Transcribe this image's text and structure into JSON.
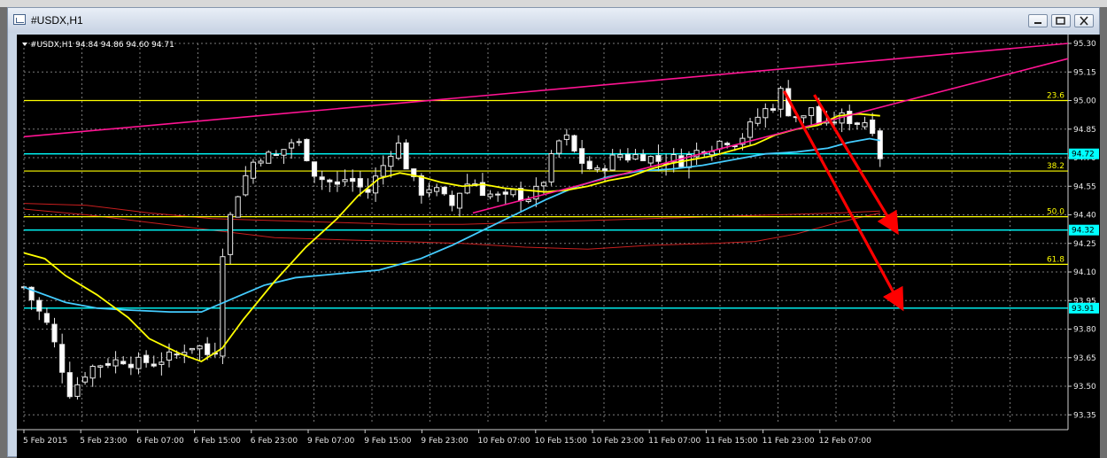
{
  "window": {
    "title": "#USDX,H1",
    "buttons": {
      "minimize": "minimize",
      "restore": "restore",
      "close": "close"
    }
  },
  "header": {
    "symbol_line": "#USDX,H1  94.84 94.86 94.60 94.71"
  },
  "colors": {
    "background": "#000000",
    "grid": "#7a7a7a",
    "bull_candle": "#ffffff",
    "bear_candle": "#ffffff",
    "fib": "#ffff00",
    "support": "#00ffff",
    "trendline": "#ff1493",
    "ma_fast": "#ffff00",
    "ma_slow": "#44ccff",
    "ma_envelope": "#c81e1e",
    "arrow": "#ff0000"
  },
  "chart_data": {
    "type": "candlestick",
    "ylim": [
      93.3,
      95.3
    ],
    "y_ticks": [
      "95.30",
      "95.15",
      "95.00",
      "94.85",
      "94.70",
      "94.55",
      "94.40",
      "94.25",
      "94.10",
      "93.95",
      "93.80",
      "93.65",
      "93.50",
      "93.35"
    ],
    "x_labels": [
      "5 Feb 2015",
      "5 Feb 23:00",
      "6 Feb 07:00",
      "6 Feb 15:00",
      "6 Feb 23:00",
      "9 Feb 07:00",
      "9 Feb 15:00",
      "9 Feb 23:00",
      "10 Feb 07:00",
      "10 Feb 15:00",
      "10 Feb 23:00",
      "11 Feb 07:00",
      "11 Feb 15:00",
      "11 Feb 23:00",
      "12 Feb 07:00"
    ],
    "bars_count": 113,
    "fib_levels": [
      {
        "label": "23.6",
        "price": 95.0
      },
      {
        "label": "38.2",
        "price": 94.63
      },
      {
        "label": "50.0",
        "price": 94.39
      },
      {
        "label": "61.8",
        "price": 94.14
      }
    ],
    "support_lines": [
      {
        "label": "94.72",
        "price": 94.72
      },
      {
        "label": "94.32",
        "price": 94.32
      },
      {
        "label": "93.91",
        "price": 93.91
      }
    ],
    "current_price": "94.71",
    "trendlines": [
      {
        "from": [
          0.0,
          94.81
        ],
        "to": [
          1.0,
          95.3
        ]
      },
      {
        "from": [
          0.43,
          94.41
        ],
        "to": [
          1.0,
          95.22
        ]
      }
    ],
    "arrows": [
      {
        "from": [
          0.728,
          95.05
        ],
        "to": [
          0.84,
          93.92
        ]
      },
      {
        "from": [
          0.757,
          95.03
        ],
        "to": [
          0.835,
          94.32
        ]
      }
    ],
    "series": [
      {
        "key": "ma_fast",
        "values": [
          [
            0,
            94.2
          ],
          [
            0.02,
            94.17
          ],
          [
            0.04,
            94.08
          ],
          [
            0.07,
            93.98
          ],
          [
            0.1,
            93.86
          ],
          [
            0.12,
            93.75
          ],
          [
            0.15,
            93.67
          ],
          [
            0.17,
            93.63
          ],
          [
            0.19,
            93.7
          ],
          [
            0.21,
            93.85
          ],
          [
            0.24,
            94.05
          ],
          [
            0.27,
            94.23
          ],
          [
            0.3,
            94.38
          ],
          [
            0.32,
            94.5
          ],
          [
            0.34,
            94.59
          ],
          [
            0.36,
            94.62
          ],
          [
            0.38,
            94.6
          ],
          [
            0.4,
            94.57
          ],
          [
            0.42,
            94.55
          ],
          [
            0.44,
            94.56
          ],
          [
            0.46,
            94.54
          ],
          [
            0.48,
            94.53
          ],
          [
            0.5,
            94.52
          ],
          [
            0.52,
            94.53
          ],
          [
            0.54,
            94.55
          ],
          [
            0.56,
            94.58
          ],
          [
            0.58,
            94.6
          ],
          [
            0.6,
            94.64
          ],
          [
            0.62,
            94.67
          ],
          [
            0.64,
            94.69
          ],
          [
            0.66,
            94.71
          ],
          [
            0.68,
            94.74
          ],
          [
            0.7,
            94.77
          ],
          [
            0.72,
            94.82
          ],
          [
            0.74,
            94.85
          ],
          [
            0.76,
            94.87
          ],
          [
            0.78,
            94.92
          ],
          [
            0.8,
            94.93
          ],
          [
            0.82,
            94.92
          ]
        ]
      },
      {
        "key": "ma_slow",
        "values": [
          [
            0,
            94.02
          ],
          [
            0.04,
            93.94
          ],
          [
            0.07,
            93.91
          ],
          [
            0.1,
            93.9
          ],
          [
            0.14,
            93.89
          ],
          [
            0.17,
            93.89
          ],
          [
            0.2,
            93.96
          ],
          [
            0.23,
            94.03
          ],
          [
            0.26,
            94.07
          ],
          [
            0.3,
            94.09
          ],
          [
            0.34,
            94.11
          ],
          [
            0.36,
            94.14
          ],
          [
            0.38,
            94.17
          ],
          [
            0.41,
            94.24
          ],
          [
            0.44,
            94.32
          ],
          [
            0.47,
            94.4
          ],
          [
            0.5,
            94.48
          ],
          [
            0.53,
            94.55
          ],
          [
            0.56,
            94.6
          ],
          [
            0.59,
            94.63
          ],
          [
            0.62,
            94.64
          ],
          [
            0.65,
            94.66
          ],
          [
            0.68,
            94.69
          ],
          [
            0.71,
            94.72
          ],
          [
            0.74,
            94.73
          ],
          [
            0.77,
            94.75
          ],
          [
            0.79,
            94.78
          ],
          [
            0.81,
            94.8
          ],
          [
            0.82,
            94.79
          ]
        ]
      },
      {
        "key": "ma_envelope",
        "values": [
          [
            0,
            94.46
          ],
          [
            0.06,
            94.45
          ],
          [
            0.12,
            94.41
          ],
          [
            0.18,
            94.38
          ],
          [
            0.24,
            94.37
          ],
          [
            0.3,
            94.36
          ],
          [
            0.36,
            94.35
          ],
          [
            0.42,
            94.35
          ],
          [
            0.48,
            94.36
          ],
          [
            0.54,
            94.37
          ],
          [
            0.6,
            94.38
          ],
          [
            0.66,
            94.39
          ],
          [
            0.72,
            94.4
          ],
          [
            0.78,
            94.41
          ],
          [
            0.82,
            94.42
          ]
        ]
      },
      {
        "key": "ma_envelope",
        "values": [
          [
            0,
            94.43
          ],
          [
            0.06,
            94.4
          ],
          [
            0.12,
            94.36
          ],
          [
            0.18,
            94.32
          ],
          [
            0.24,
            94.28
          ],
          [
            0.3,
            94.27
          ],
          [
            0.36,
            94.26
          ],
          [
            0.42,
            94.25
          ],
          [
            0.48,
            94.23
          ],
          [
            0.54,
            94.22
          ],
          [
            0.6,
            94.24
          ],
          [
            0.66,
            94.25
          ],
          [
            0.7,
            94.26
          ],
          [
            0.74,
            94.3
          ],
          [
            0.78,
            94.36
          ],
          [
            0.82,
            94.41
          ]
        ]
      }
    ],
    "price_path": [
      [
        0,
        94.02
      ],
      [
        0.005,
        93.98
      ],
      [
        0.01,
        93.93
      ],
      [
        0.018,
        93.86
      ],
      [
        0.025,
        93.8
      ],
      [
        0.035,
        93.62
      ],
      [
        0.045,
        93.45
      ],
      [
        0.055,
        93.55
      ],
      [
        0.065,
        93.6
      ],
      [
        0.075,
        93.62
      ],
      [
        0.085,
        93.63
      ],
      [
        0.095,
        93.64
      ],
      [
        0.105,
        93.62
      ],
      [
        0.115,
        93.63
      ],
      [
        0.125,
        93.62
      ],
      [
        0.135,
        93.65
      ],
      [
        0.145,
        93.66
      ],
      [
        0.155,
        93.7
      ],
      [
        0.165,
        93.72
      ],
      [
        0.175,
        93.68
      ],
      [
        0.18,
        93.6
      ],
      [
        0.185,
        93.75
      ],
      [
        0.19,
        94.2
      ],
      [
        0.2,
        94.45
      ],
      [
        0.21,
        94.58
      ],
      [
        0.22,
        94.68
      ],
      [
        0.23,
        94.72
      ],
      [
        0.24,
        94.7
      ],
      [
        0.25,
        94.75
      ],
      [
        0.26,
        94.8
      ],
      [
        0.27,
        94.72
      ],
      [
        0.28,
        94.6
      ],
      [
        0.29,
        94.58
      ],
      [
        0.3,
        94.55
      ],
      [
        0.31,
        94.6
      ],
      [
        0.32,
        94.55
      ],
      [
        0.33,
        94.52
      ],
      [
        0.34,
        94.63
      ],
      [
        0.35,
        94.7
      ],
      [
        0.355,
        94.82
      ],
      [
        0.36,
        94.75
      ],
      [
        0.37,
        94.6
      ],
      [
        0.38,
        94.52
      ],
      [
        0.39,
        94.55
      ],
      [
        0.4,
        94.5
      ],
      [
        0.41,
        94.45
      ],
      [
        0.42,
        94.55
      ],
      [
        0.43,
        94.58
      ],
      [
        0.44,
        94.52
      ],
      [
        0.45,
        94.5
      ],
      [
        0.46,
        94.48
      ],
      [
        0.47,
        94.52
      ],
      [
        0.48,
        94.48
      ],
      [
        0.49,
        94.52
      ],
      [
        0.5,
        94.6
      ],
      [
        0.51,
        94.78
      ],
      [
        0.52,
        94.8
      ],
      [
        0.53,
        94.7
      ],
      [
        0.54,
        94.65
      ],
      [
        0.55,
        94.62
      ],
      [
        0.56,
        94.68
      ],
      [
        0.57,
        94.72
      ],
      [
        0.58,
        94.7
      ],
      [
        0.59,
        94.72
      ],
      [
        0.6,
        94.7
      ],
      [
        0.61,
        94.68
      ],
      [
        0.62,
        94.7
      ],
      [
        0.63,
        94.68
      ],
      [
        0.64,
        94.72
      ],
      [
        0.65,
        94.75
      ],
      [
        0.66,
        94.76
      ],
      [
        0.67,
        94.8
      ],
      [
        0.68,
        94.78
      ],
      [
        0.69,
        94.82
      ],
      [
        0.7,
        94.9
      ],
      [
        0.71,
        94.95
      ],
      [
        0.72,
        94.98
      ],
      [
        0.725,
        95.05
      ],
      [
        0.73,
        94.95
      ],
      [
        0.74,
        94.92
      ],
      [
        0.75,
        94.9
      ],
      [
        0.755,
        94.98
      ],
      [
        0.76,
        94.88
      ],
      [
        0.77,
        94.86
      ],
      [
        0.78,
        94.92
      ],
      [
        0.79,
        94.9
      ],
      [
        0.8,
        94.88
      ],
      [
        0.81,
        94.9
      ],
      [
        0.815,
        94.82
      ],
      [
        0.82,
        94.71
      ]
    ]
  }
}
